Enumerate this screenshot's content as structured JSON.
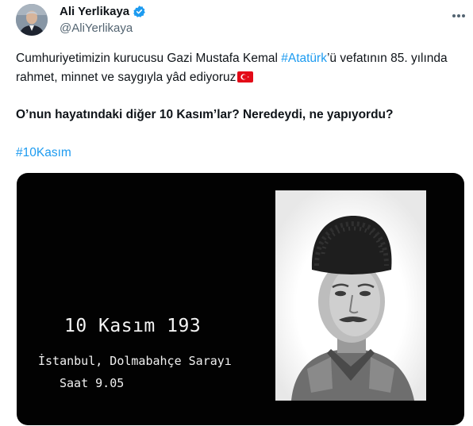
{
  "author": {
    "display_name": "Ali Yerlikaya",
    "handle": "@AliYerlikaya",
    "verified_color": "#1d9bf0"
  },
  "tweet": {
    "line1_a": "Cumhuriyetimizin kurucusu Gazi Mustafa Kemal ",
    "line1_hashtag": "#Atatürk",
    "line1_b": "’ü vefatının 85. yılında rahmet, minnet ve saygıyla yâd ediyoruz",
    "line2": "O’nun hayatındaki diğer 10 Kasım’lar? Neredeydi, ne yapıyordu?",
    "hashtag": "#10Kasım",
    "flag_icon": "turkey-flag-icon"
  },
  "media": {
    "date_text": "10 Kasım 193",
    "place_text": "İstanbul, Dolmabahçe Sarayı",
    "time_text": "Saat 9.05"
  },
  "colors": {
    "link": "#1d9bf0",
    "text": "#0f1419",
    "secondary": "#536471"
  }
}
